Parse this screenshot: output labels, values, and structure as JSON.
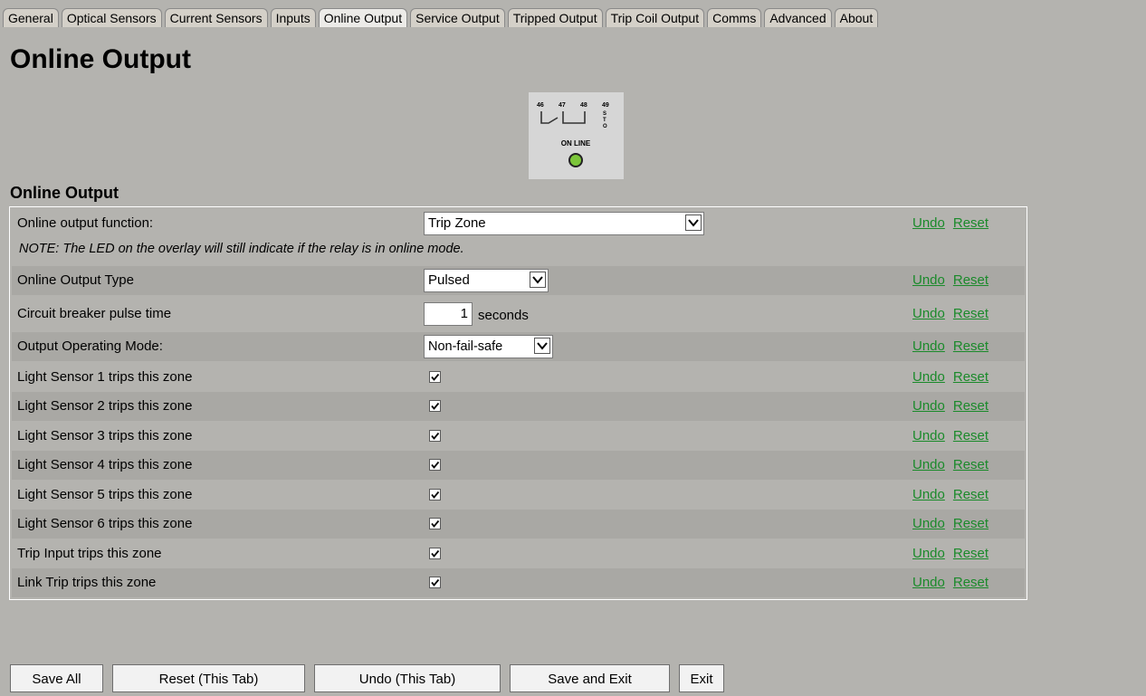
{
  "tabs": [
    {
      "label": "General"
    },
    {
      "label": "Optical Sensors"
    },
    {
      "label": "Current Sensors"
    },
    {
      "label": "Inputs"
    },
    {
      "label": "Online Output",
      "active": true
    },
    {
      "label": "Service Output"
    },
    {
      "label": "Tripped Output"
    },
    {
      "label": "Trip Coil Output"
    },
    {
      "label": "Comms"
    },
    {
      "label": "Advanced"
    },
    {
      "label": "About"
    }
  ],
  "page_title": "Online Output",
  "overlay": {
    "terminals": [
      "46",
      "47",
      "48",
      "49"
    ],
    "sto": "STO",
    "caption": "ON LINE",
    "led_color": "#7cc63a"
  },
  "section_title": "Online Output",
  "undo_label": "Undo",
  "reset_label": "Reset",
  "colors": {
    "link": "#1a8a2a",
    "background": "#b4b3af",
    "row_shade": "#a9a8a4"
  },
  "settings": {
    "function_label": "Online output function:",
    "function_value": "Trip Zone",
    "note": "NOTE: The LED on the overlay will still indicate if the relay is in online mode.",
    "type_label": "Online Output Type",
    "type_value": "Pulsed",
    "pulse_label": "Circuit breaker pulse time",
    "pulse_value": "1",
    "pulse_unit": "seconds",
    "mode_label": "Output Operating Mode:",
    "mode_value": "Non-fail-safe",
    "checks": [
      {
        "label": "Light Sensor 1 trips this zone",
        "checked": true
      },
      {
        "label": "Light Sensor 2 trips this zone",
        "checked": true
      },
      {
        "label": "Light Sensor 3 trips this zone",
        "checked": true
      },
      {
        "label": "Light Sensor 4 trips this zone",
        "checked": true
      },
      {
        "label": "Light Sensor 5 trips this zone",
        "checked": true
      },
      {
        "label": "Light Sensor 6 trips this zone",
        "checked": true
      },
      {
        "label": "Trip Input trips this zone",
        "checked": true
      },
      {
        "label": "Link Trip trips this zone",
        "checked": true
      }
    ]
  },
  "buttons": {
    "save_all": "Save All",
    "reset_tab": "Reset (This Tab)",
    "undo_tab": "Undo (This Tab)",
    "save_exit": "Save and Exit",
    "exit": "Exit"
  }
}
